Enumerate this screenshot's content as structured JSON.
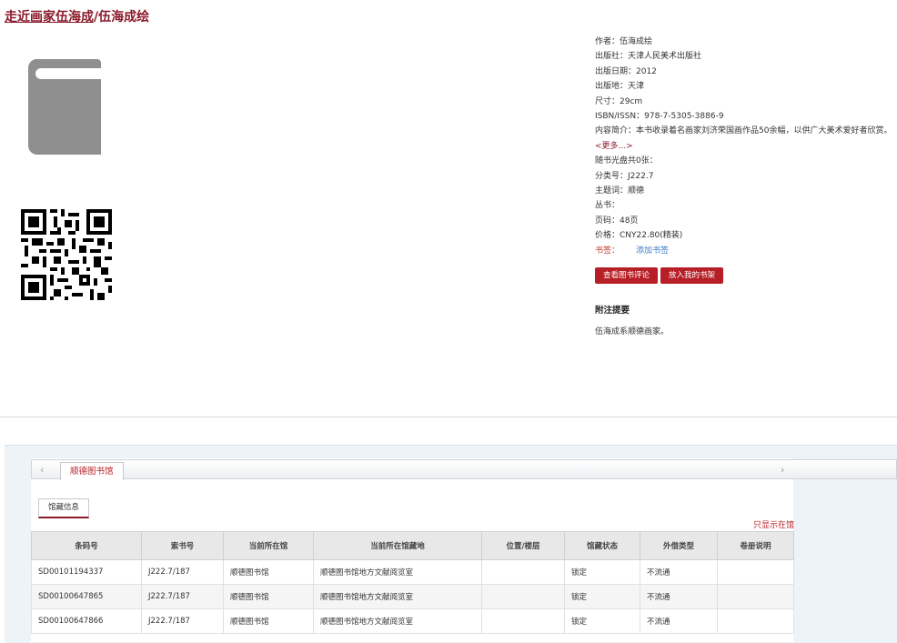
{
  "title": {
    "part1": "走近画家伍海成",
    "separator": "/",
    "part2": "伍海成绘"
  },
  "meta": {
    "author": "作者：伍海成绘",
    "publisher": "出版社：天津人民美术出版社",
    "pub_date": "出版日期：2012",
    "pub_place": "出版地：天津",
    "size": "尺寸：29cm",
    "isbn": "ISBN/ISSN：978-7-5305-3886-9",
    "summary": "内容简介：本书收录着名画家刘济荣国画作品50余幅，以供广大美术爱好者欣赏。",
    "more": "<更多...>",
    "cd": "随书光盘共0张：",
    "class_no": "分类号：J222.7",
    "subject": "主题词：顺德",
    "series": "丛书：",
    "pages": "页码：48页",
    "price": "价格：CNY22.80(精装)",
    "tags_label": "书签：",
    "tags_link": "添加书签"
  },
  "buttons": {
    "review": "查看图书评论",
    "shelf": "放入我的书架"
  },
  "notes": {
    "heading": "附注提要",
    "text": "伍海成系顺德画家。"
  },
  "icons": {
    "book": "book-icon",
    "qr": "qr-code",
    "prev": "chevron-left-icon",
    "next": "chevron-right-icon"
  },
  "tabs": {
    "library": "顺德图书馆",
    "sub": "馆藏信息",
    "only_show": "只显示在馆"
  },
  "table": {
    "headers": [
      "条码号",
      "索书号",
      "当前所在馆",
      "当前所在馆藏地",
      "位置/楼层",
      "馆藏状态",
      "外借类型",
      "卷册说明"
    ],
    "rows": [
      [
        "SD00101194337",
        "J222.7/187",
        "顺德图书馆",
        "顺德图书馆地方文献阅览室",
        "",
        "锁定",
        "不流通",
        ""
      ],
      [
        "SD00100647865",
        "J222.7/187",
        "顺德图书馆",
        "顺德图书馆地方文献阅览室",
        "",
        "锁定",
        "不流通",
        ""
      ],
      [
        "SD00100647866",
        "J222.7/187",
        "顺德图书馆",
        "顺德图书馆地方文献阅览室",
        "",
        "锁定",
        "不流通",
        ""
      ]
    ]
  },
  "colors": {
    "accent": "#8a1a2a",
    "button": "#b61f25",
    "link": "#3b7cc4"
  }
}
